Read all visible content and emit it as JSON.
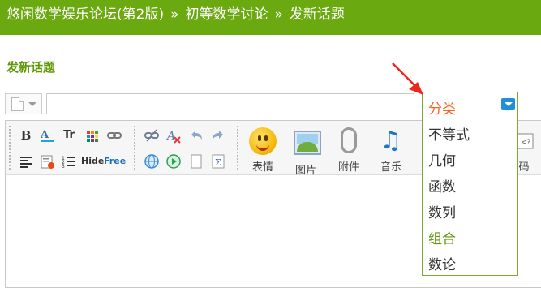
{
  "breadcrumb": {
    "forum": "悠闲数学娱乐论坛(第2版)",
    "sep1": "»",
    "board": "初等数学讨论",
    "sep2": "»",
    "current": "发新话题"
  },
  "page_title": "发新话题",
  "toolbar": {
    "bold": "B",
    "font_size": "Tr",
    "hide": "Hide",
    "free": "Free",
    "smiley_label": "表情",
    "image_label": "图片",
    "attach_label": "附件",
    "music_label": "音乐",
    "code_label": "码"
  },
  "category_dropdown": {
    "header": "分类",
    "options": [
      "不等式",
      "几何",
      "函数",
      "数列",
      "组合",
      "数论"
    ],
    "highlighted": "组合"
  },
  "colors": {
    "topbar": "#6aa90f",
    "title": "#5e9a06",
    "dropdown_header": "#f26522",
    "arrow": "#e8291c"
  },
  "icons": [
    "doc-icon",
    "smiley-icon",
    "picture-icon",
    "paperclip-icon",
    "music-icon"
  ]
}
